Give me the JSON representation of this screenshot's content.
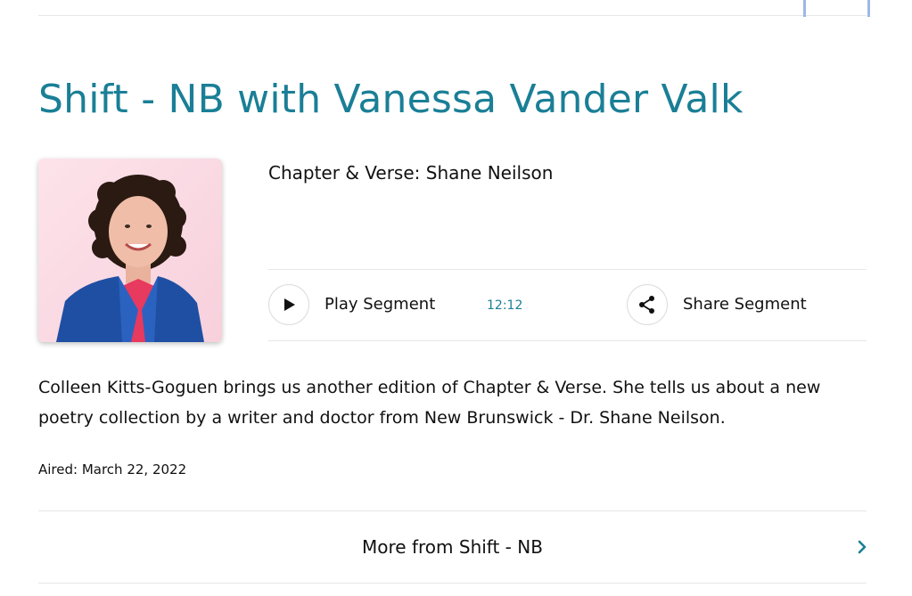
{
  "show": {
    "title": "Shift - NB with Vanessa Vander Valk"
  },
  "segment": {
    "title": "Chapter & Verse: Shane Neilson",
    "play_label": "Play Segment",
    "duration": "12:12",
    "share_label": "Share Segment",
    "description": "Colleen Kitts-Goguen brings us another edition of Chapter & Verse. She tells us about a new poetry collection by a writer and doctor from New Brunswick - Dr. Shane Neilson.",
    "aired": "Aired: March 22, 2022"
  },
  "more": {
    "label": "More from Shift - NB"
  },
  "icons": {
    "play": "play-icon",
    "share": "share-icon",
    "chevron": "chevron-right-icon"
  },
  "colors": {
    "accent": "#1a7f96",
    "divider": "#e6e6e6",
    "text": "#111111"
  }
}
